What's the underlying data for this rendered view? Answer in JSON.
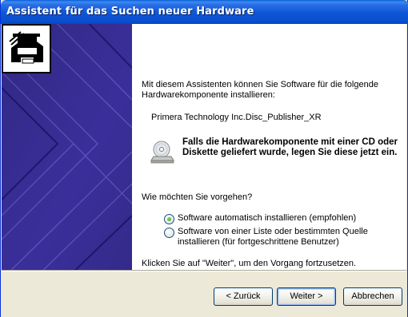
{
  "window": {
    "title": "Assistent für das Suchen neuer Hardware"
  },
  "icons": {
    "hardware": "hardware-card-icon",
    "cd": "cd-drive-icon"
  },
  "colors": {
    "titlebar": "#0a4fd0",
    "banner": "#3a2f9a",
    "dialog_bg": "#ece9d8"
  },
  "main": {
    "intro": "Mit diesem Assistenten können Sie Software für die folgende Hardwarekomponente installieren:",
    "device_name": "Primera Technology Inc.Disc_Publisher_XR",
    "cd_note": "Falls die Hardwarekomponente mit einer CD oder Diskette geliefert wurde, legen Sie diese jetzt ein.",
    "question": "Wie möchten Sie vorgehen?",
    "options": [
      {
        "label": "Software automatisch installieren (empfohlen)",
        "selected": true
      },
      {
        "label": "Software von einer Liste oder bestimmten Quelle installieren (für fortgeschrittene Benutzer)",
        "selected": false
      }
    ],
    "continue_hint": "Klicken Sie auf \"Weiter\", um den Vorgang fortzusetzen."
  },
  "buttons": {
    "back": "< Zurück",
    "next": "Weiter >",
    "cancel": "Abbrechen"
  }
}
